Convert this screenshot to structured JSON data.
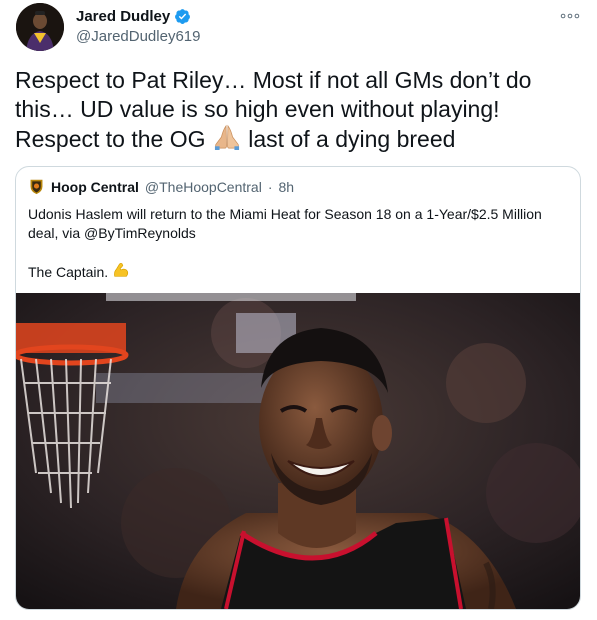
{
  "author": {
    "display_name": "Jared Dudley",
    "handle": "@JaredDudley619",
    "verified_icon": "verified-badge-icon"
  },
  "tweet": {
    "text": "Respect to Pat Riley… Most if not all GMs don’t do this… UD value is so high even without playing! Respect to the OG",
    "text_tail": " last of a dying breed",
    "emoji": "folded-hands-icon"
  },
  "menu": {
    "icon": "more-options-icon"
  },
  "quoted_tweet": {
    "display_name": "Hoop Central",
    "handle": "@TheHoopCentral",
    "separator": "·",
    "time": "8h",
    "text": "Udonis Haslem will return to the Miami Heat for Season 18 on a 1-Year/$2.5 Million deal, via @ByTimReynolds",
    "caption": "The Captain.",
    "caption_emoji": "flexed-biceps-icon",
    "image": "smiling-basketball-player-photo"
  },
  "colors": {
    "text": "#0f1419",
    "secondary": "#536471",
    "verified_blue": "#1d9bf0",
    "border": "#cfd9de",
    "heat_red": "#c8102e"
  }
}
